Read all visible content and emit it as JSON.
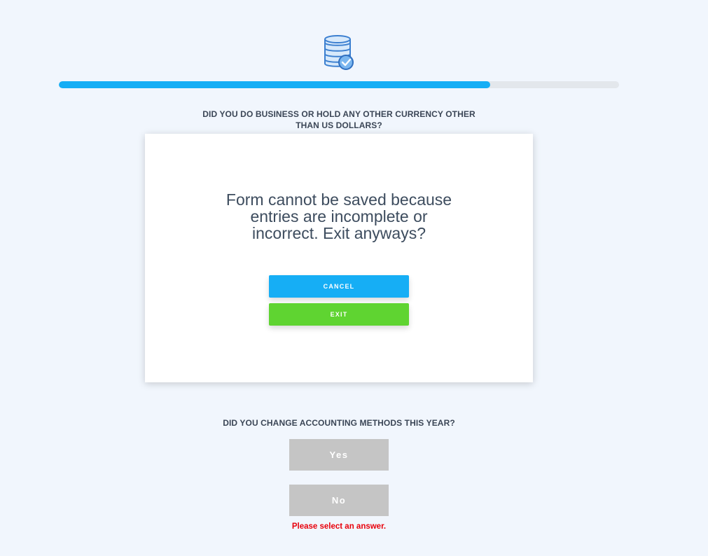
{
  "theme": {
    "progress_color": "#16aef5",
    "cancel_color": "#16aef5",
    "exit_color": "#5fd431",
    "error_color": "#e8000b",
    "answer_button_color": "#c5c5c5"
  },
  "header": {
    "logo_icon": "database-check-icon",
    "progress_fraction": 0.77
  },
  "questions": [
    {
      "text": "DID YOU DO BUSINESS OR HOLD ANY OTHER CURRENCY OTHER THAN US DOLLARS?",
      "error": "Please select an answer."
    },
    {
      "text": "DID YOU CHANGE ACCOUNTING METHODS THIS YEAR?",
      "yes_label": "Yes",
      "no_label": "No",
      "error": "Please select an answer."
    }
  ],
  "modal": {
    "message": "Form cannot be saved because entries are incomplete or incorrect. Exit anyways?",
    "cancel_label": "CANCEL",
    "exit_label": "EXIT"
  }
}
